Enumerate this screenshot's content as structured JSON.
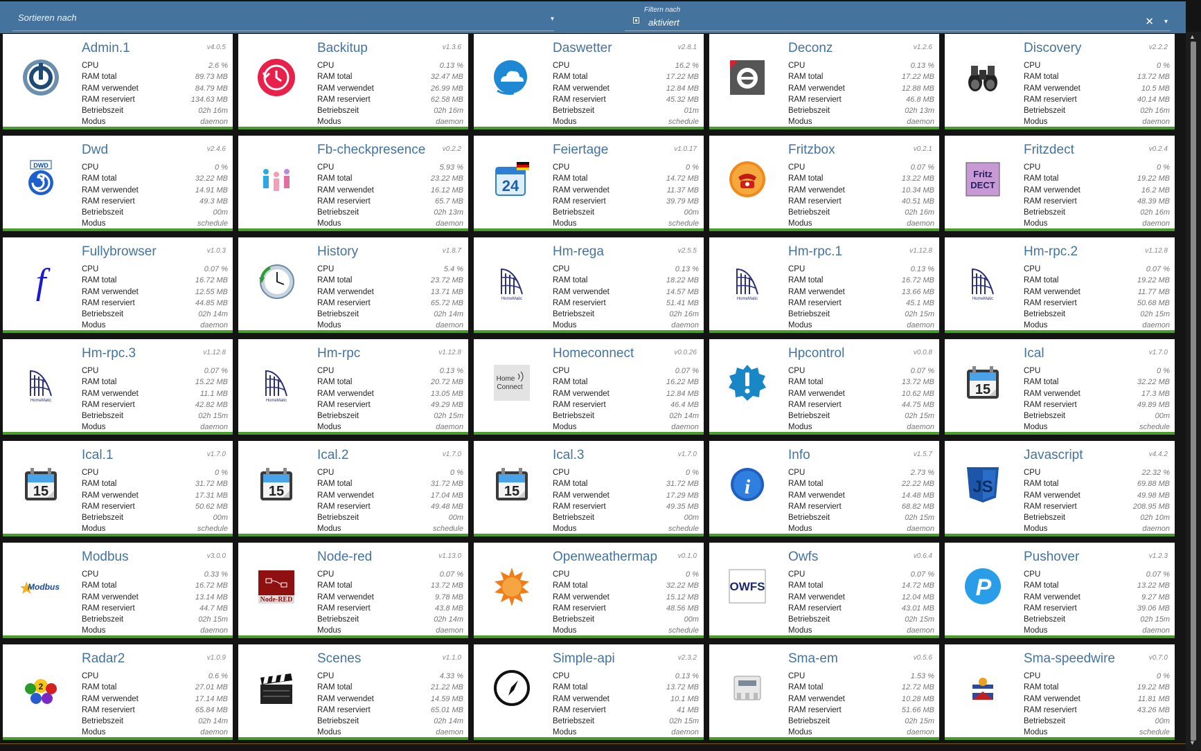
{
  "toolbar": {
    "sort_label": "Sortieren nach",
    "filter_label": "Filtern nach",
    "filter_value": "aktiviert",
    "clear_glyph": "✕",
    "dropdown_glyph": "▾"
  },
  "stat_labels": {
    "cpu": "CPU",
    "ram_total": "RAM total",
    "ram_used": "RAM verwendet",
    "ram_reserved": "RAM reserviert",
    "uptime": "Betriebszeit",
    "mode": "Modus"
  },
  "colors": {
    "accent": "#44739e",
    "status_ok": "#4a9d2a",
    "background": "#141414"
  },
  "instances": [
    {
      "name": "Admin.1",
      "version": "v4.0.5",
      "cpu": "2.6 %",
      "ram_total": "89.73 MB",
      "ram_used": "84.79 MB",
      "ram_reserved": "134.63 MB",
      "uptime": "02h 16m",
      "mode": "daemon",
      "icon": "admin-icon"
    },
    {
      "name": "Backitup",
      "version": "v1.3.6",
      "cpu": "0.13 %",
      "ram_total": "32.47 MB",
      "ram_used": "26.99 MB",
      "ram_reserved": "62.58 MB",
      "uptime": "02h 16m",
      "mode": "daemon",
      "icon": "backitup-icon"
    },
    {
      "name": "Daswetter",
      "version": "v2.8.1",
      "cpu": "16.2 %",
      "ram_total": "17.22 MB",
      "ram_used": "12.84 MB",
      "ram_reserved": "45.32 MB",
      "uptime": "01m",
      "mode": "schedule",
      "icon": "weather-cloud-icon"
    },
    {
      "name": "Deconz",
      "version": "v1.2.6",
      "cpu": "0.13 %",
      "ram_total": "17.22 MB",
      "ram_used": "12.88 MB",
      "ram_reserved": "46.8 MB",
      "uptime": "02h 13m",
      "mode": "daemon",
      "icon": "deconz-icon"
    },
    {
      "name": "Discovery",
      "version": "v2.2.2",
      "cpu": "0 %",
      "ram_total": "13.72 MB",
      "ram_used": "10.5 MB",
      "ram_reserved": "40.14 MB",
      "uptime": "02h 16m",
      "mode": "daemon",
      "icon": "binoculars-icon"
    },
    {
      "name": "Dwd",
      "version": "v2.4.6",
      "cpu": "0 %",
      "ram_total": "32.22 MB",
      "ram_used": "14.91 MB",
      "ram_reserved": "49.3 MB",
      "uptime": "00m",
      "mode": "schedule",
      "icon": "dwd-icon"
    },
    {
      "name": "Fb-checkpresence",
      "version": "v0.2.2",
      "cpu": "5.93 %",
      "ram_total": "23.22 MB",
      "ram_used": "16.12 MB",
      "ram_reserved": "65.7 MB",
      "uptime": "02h 13m",
      "mode": "daemon",
      "icon": "presence-icon"
    },
    {
      "name": "Feiertage",
      "version": "v1.0.17",
      "cpu": "0 %",
      "ram_total": "14.72 MB",
      "ram_used": "11.37 MB",
      "ram_reserved": "39.79 MB",
      "uptime": "00m",
      "mode": "schedule",
      "icon": "calendar-24-icon"
    },
    {
      "name": "Fritzbox",
      "version": "v0.2.1",
      "cpu": "0.07 %",
      "ram_total": "13.22 MB",
      "ram_used": "10.34 MB",
      "ram_reserved": "40.51 MB",
      "uptime": "02h 16m",
      "mode": "daemon",
      "icon": "phone-icon"
    },
    {
      "name": "Fritzdect",
      "version": "v0.2.4",
      "cpu": "0 %",
      "ram_total": "19.22 MB",
      "ram_used": "16.2 MB",
      "ram_reserved": "48.39 MB",
      "uptime": "02h 16m",
      "mode": "daemon",
      "icon": "fritzdect-icon"
    },
    {
      "name": "Fullybrowser",
      "version": "v1.0.3",
      "cpu": "0.07 %",
      "ram_total": "16.72 MB",
      "ram_used": "12.55 MB",
      "ram_reserved": "44.85 MB",
      "uptime": "02h 14m",
      "mode": "daemon",
      "icon": "fully-icon"
    },
    {
      "name": "History",
      "version": "v1.8.7",
      "cpu": "5.4 %",
      "ram_total": "23.72 MB",
      "ram_used": "13.71 MB",
      "ram_reserved": "65.72 MB",
      "uptime": "02h 14m",
      "mode": "daemon",
      "icon": "history-clock-icon"
    },
    {
      "name": "Hm-rega",
      "version": "v2.5.5",
      "cpu": "0.13 %",
      "ram_total": "18.22 MB",
      "ram_used": "14.57 MB",
      "ram_reserved": "51.41 MB",
      "uptime": "02h 16m",
      "mode": "daemon",
      "icon": "homematic-icon"
    },
    {
      "name": "Hm-rpc.1",
      "version": "v1.12.8",
      "cpu": "0.13 %",
      "ram_total": "16.72 MB",
      "ram_used": "13.66 MB",
      "ram_reserved": "45.1 MB",
      "uptime": "02h 15m",
      "mode": "daemon",
      "icon": "homematic-icon"
    },
    {
      "name": "Hm-rpc.2",
      "version": "v1.12.8",
      "cpu": "0.07 %",
      "ram_total": "19.22 MB",
      "ram_used": "11.77 MB",
      "ram_reserved": "50.68 MB",
      "uptime": "02h 15m",
      "mode": "daemon",
      "icon": "homematic-icon"
    },
    {
      "name": "Hm-rpc.3",
      "version": "v1.12.8",
      "cpu": "0.07 %",
      "ram_total": "15.22 MB",
      "ram_used": "11.1 MB",
      "ram_reserved": "42.82 MB",
      "uptime": "02h 15m",
      "mode": "daemon",
      "icon": "homematic-icon"
    },
    {
      "name": "Hm-rpc",
      "version": "v1.12.8",
      "cpu": "0.13 %",
      "ram_total": "20.72 MB",
      "ram_used": "13.05 MB",
      "ram_reserved": "49.29 MB",
      "uptime": "02h 15m",
      "mode": "daemon",
      "icon": "homematic-icon"
    },
    {
      "name": "Homeconnect",
      "version": "v0.0.26",
      "cpu": "0.07 %",
      "ram_total": "16.22 MB",
      "ram_used": "12.84 MB",
      "ram_reserved": "46.4 MB",
      "uptime": "02h 14m",
      "mode": "daemon",
      "icon": "homeconnect-icon"
    },
    {
      "name": "Hpcontrol",
      "version": "v0.0.8",
      "cpu": "0.07 %",
      "ram_total": "13.72 MB",
      "ram_used": "10.62 MB",
      "ram_reserved": "44.75 MB",
      "uptime": "02h 15m",
      "mode": "daemon",
      "icon": "exclamation-badge-icon"
    },
    {
      "name": "Ical",
      "version": "v1.7.0",
      "cpu": "0 %",
      "ram_total": "32.22 MB",
      "ram_used": "17.3 MB",
      "ram_reserved": "49.89 MB",
      "uptime": "00m",
      "mode": "schedule",
      "icon": "calendar-15-icon"
    },
    {
      "name": "Ical.1",
      "version": "v1.7.0",
      "cpu": "0 %",
      "ram_total": "31.72 MB",
      "ram_used": "17.31 MB",
      "ram_reserved": "50.62 MB",
      "uptime": "00m",
      "mode": "schedule",
      "icon": "calendar-15-icon"
    },
    {
      "name": "Ical.2",
      "version": "v1.7.0",
      "cpu": "0 %",
      "ram_total": "31.72 MB",
      "ram_used": "17.04 MB",
      "ram_reserved": "49.48 MB",
      "uptime": "00m",
      "mode": "schedule",
      "icon": "calendar-15-icon"
    },
    {
      "name": "Ical.3",
      "version": "v1.7.0",
      "cpu": "0 %",
      "ram_total": "31.72 MB",
      "ram_used": "17.29 MB",
      "ram_reserved": "49.35 MB",
      "uptime": "00m",
      "mode": "schedule",
      "icon": "calendar-15-icon"
    },
    {
      "name": "Info",
      "version": "v1.5.7",
      "cpu": "2.73 %",
      "ram_total": "22.22 MB",
      "ram_used": "14.48 MB",
      "ram_reserved": "68.82 MB",
      "uptime": "02h 15m",
      "mode": "daemon",
      "icon": "info-icon"
    },
    {
      "name": "Javascript",
      "version": "v4.4.2",
      "cpu": "22.32 %",
      "ram_total": "69.88 MB",
      "ram_used": "49.98 MB",
      "ram_reserved": "208.95 MB",
      "uptime": "02h 10m",
      "mode": "daemon",
      "icon": "js-shield-icon"
    },
    {
      "name": "Modbus",
      "version": "v3.0.0",
      "cpu": "0.33 %",
      "ram_total": "16.72 MB",
      "ram_used": "13.14 MB",
      "ram_reserved": "44.7 MB",
      "uptime": "02h 15m",
      "mode": "daemon",
      "icon": "modbus-icon"
    },
    {
      "name": "Node-red",
      "version": "v1.13.0",
      "cpu": "0.07 %",
      "ram_total": "13.72 MB",
      "ram_used": "9.78 MB",
      "ram_reserved": "43.8 MB",
      "uptime": "02h 14m",
      "mode": "daemon",
      "icon": "node-red-icon"
    },
    {
      "name": "Openweathermap",
      "version": "v0.1.0",
      "cpu": "0 %",
      "ram_total": "32.22 MB",
      "ram_used": "15.12 MB",
      "ram_reserved": "48.56 MB",
      "uptime": "00m",
      "mode": "schedule",
      "icon": "sun-icon"
    },
    {
      "name": "Owfs",
      "version": "v0.6.4",
      "cpu": "0.07 %",
      "ram_total": "14.72 MB",
      "ram_used": "12.04 MB",
      "ram_reserved": "43.01 MB",
      "uptime": "02h 15m",
      "mode": "daemon",
      "icon": "owfs-icon"
    },
    {
      "name": "Pushover",
      "version": "v1.2.3",
      "cpu": "0.07 %",
      "ram_total": "13.22 MB",
      "ram_used": "9.27 MB",
      "ram_reserved": "39.06 MB",
      "uptime": "02h 15m",
      "mode": "daemon",
      "icon": "pushover-icon"
    },
    {
      "name": "Radar2",
      "version": "v1.0.9",
      "cpu": "0.6 %",
      "ram_total": "27.01 MB",
      "ram_used": "17.14 MB",
      "ram_reserved": "65.84 MB",
      "uptime": "02h 14m",
      "mode": "daemon",
      "icon": "radar-people-icon"
    },
    {
      "name": "Scenes",
      "version": "v1.1.0",
      "cpu": "4.33 %",
      "ram_total": "21.22 MB",
      "ram_used": "14.59 MB",
      "ram_reserved": "65.01 MB",
      "uptime": "02h 14m",
      "mode": "daemon",
      "icon": "clapperboard-icon"
    },
    {
      "name": "Simple-api",
      "version": "v2.3.2",
      "cpu": "0.13 %",
      "ram_total": "13.72 MB",
      "ram_used": "10.1 MB",
      "ram_reserved": "41 MB",
      "uptime": "02h 15m",
      "mode": "daemon",
      "icon": "compass-icon"
    },
    {
      "name": "Sma-em",
      "version": "v0.5.6",
      "cpu": "1.53 %",
      "ram_total": "12.72 MB",
      "ram_used": "10.28 MB",
      "ram_reserved": "51.66 MB",
      "uptime": "02h 15m",
      "mode": "daemon",
      "icon": "energy-meter-icon"
    },
    {
      "name": "Sma-speedwire",
      "version": "v0.7.0",
      "cpu": "0 %",
      "ram_total": "19.22 MB",
      "ram_used": "11.81 MB",
      "ram_reserved": "43.26 MB",
      "uptime": "00m",
      "mode": "schedule",
      "icon": "sma-icon"
    }
  ],
  "icon_text": {
    "dwd": "DWD",
    "fritz_line1": "Fritz",
    "fritz_line2": "DECT",
    "cal_24": "24",
    "cal_15": "15",
    "homeconnect_line1": "Home",
    "homeconnect_line2": "Connect",
    "homematic": "HomeMatic",
    "modbus": "Modbus",
    "nodered": "Node-RED",
    "owfs": "OWFS",
    "js": "JS",
    "fully": "f",
    "pushover": "P",
    "info": "i"
  }
}
